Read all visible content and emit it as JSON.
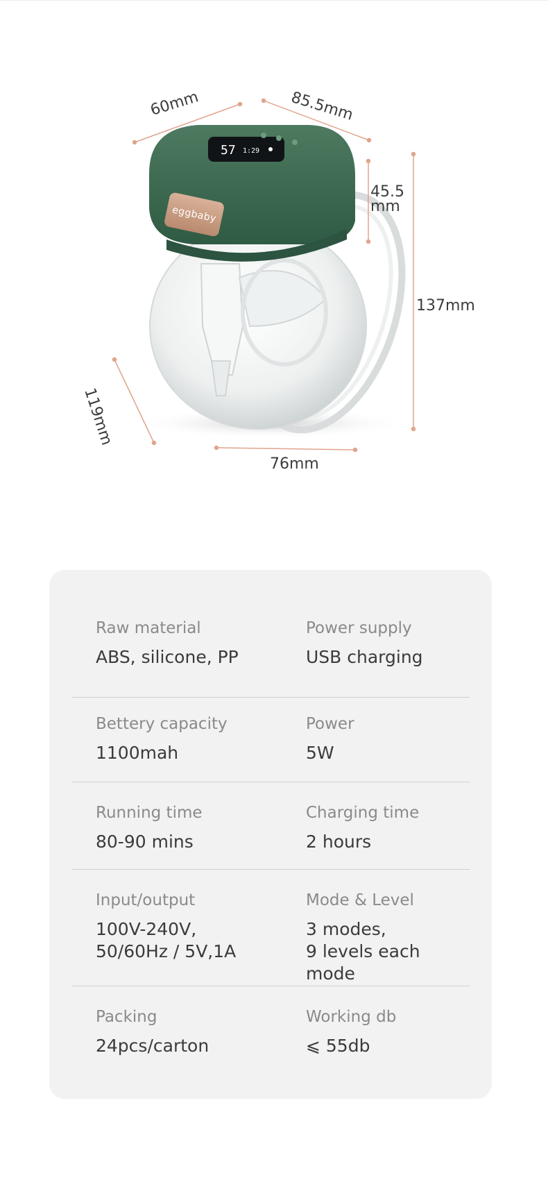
{
  "product": {
    "brand": "eggbaby",
    "dimensions": {
      "width_a": "60mm",
      "width_b": "85.5mm",
      "head_height": "45.5\nmm",
      "total_height": "137mm",
      "depth": "119mm",
      "base": "76mm"
    }
  },
  "specs": [
    {
      "left": {
        "label": "Raw material",
        "value": "ABS, silicone, PP"
      },
      "right": {
        "label": "Power supply",
        "value": "USB charging"
      }
    },
    {
      "left": {
        "label": "Bettery capacity",
        "value": "1100mah"
      },
      "right": {
        "label": "Power",
        "value": "5W"
      }
    },
    {
      "left": {
        "label": "Running time",
        "value": "80-90 mins"
      },
      "right": {
        "label": "Charging time",
        "value": "2 hours"
      }
    },
    {
      "left": {
        "label": "Input/output",
        "value": "100V-240V,\n50/60Hz / 5V,1A"
      },
      "right": {
        "label": "Mode & Level",
        "value": "3 modes,\n9 levels each mode"
      }
    },
    {
      "left": {
        "label": "Packing",
        "value": "24pcs/carton"
      },
      "right": {
        "label": "Working db",
        "value": "⩽ 55db"
      }
    }
  ],
  "colors": {
    "body_green": "#3f6b52",
    "dimension_line": "#e0a48c",
    "card_bg": "#f2f2f2"
  }
}
